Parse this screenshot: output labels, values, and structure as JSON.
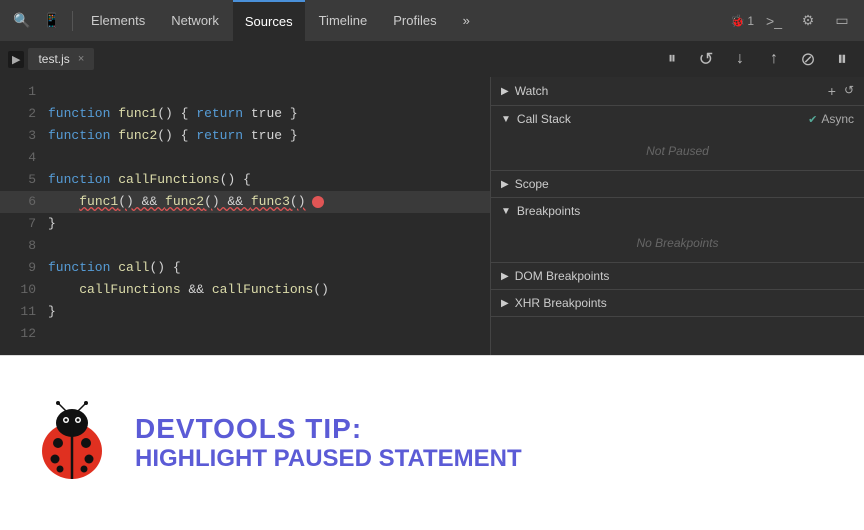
{
  "toolbar": {
    "tabs": [
      {
        "label": "Elements",
        "active": false
      },
      {
        "label": "Network",
        "active": false
      },
      {
        "label": "Sources",
        "active": true
      },
      {
        "label": "Timeline",
        "active": false
      },
      {
        "label": "Profiles",
        "active": false
      }
    ],
    "more_icon": "»",
    "bug_count": "1",
    "terminal_icon": ">_",
    "settings_icon": "⚙",
    "screen_icon": "▭"
  },
  "debug_toolbar": {
    "file_tab": "test.js",
    "play_icon": "▶",
    "step_over_icon": "⤼",
    "step_into_icon": "↓",
    "step_out_icon": "↑",
    "deactivate_icon": "⊘",
    "pause_icon": "⏸"
  },
  "code": {
    "lines": [
      {
        "num": "1",
        "content": ""
      },
      {
        "num": "2",
        "content": "function func1() { return true }"
      },
      {
        "num": "3",
        "content": "function func2() { return true }"
      },
      {
        "num": "4",
        "content": ""
      },
      {
        "num": "5",
        "content": "function callFunctions() {"
      },
      {
        "num": "6",
        "content": "    func1() && func2() && func3()",
        "highlight": true,
        "error": true
      },
      {
        "num": "7",
        "content": "}"
      },
      {
        "num": "8",
        "content": ""
      },
      {
        "num": "9",
        "content": "function call() {"
      },
      {
        "num": "10",
        "content": "    callFunctions && callFunctions()"
      },
      {
        "num": "11",
        "content": "}"
      },
      {
        "num": "12",
        "content": ""
      }
    ]
  },
  "right_panel": {
    "sections": [
      {
        "id": "watch",
        "label": "Watch",
        "expanded": false,
        "actions": [
          "+",
          "↺"
        ]
      },
      {
        "id": "call-stack",
        "label": "Call Stack",
        "expanded": true,
        "async_check": true,
        "async_label": "Async",
        "empty_text": "Not Paused"
      },
      {
        "id": "scope",
        "label": "Scope",
        "expanded": false
      },
      {
        "id": "breakpoints",
        "label": "Breakpoints",
        "expanded": true,
        "empty_text": "No Breakpoints"
      },
      {
        "id": "dom-breakpoints",
        "label": "DOM Breakpoints",
        "expanded": false
      },
      {
        "id": "xhr-breakpoints",
        "label": "XHR Breakpoints",
        "expanded": false
      }
    ]
  },
  "tip": {
    "line1": "DevTools Tip:",
    "line2": "Highlight Paused Statement"
  }
}
